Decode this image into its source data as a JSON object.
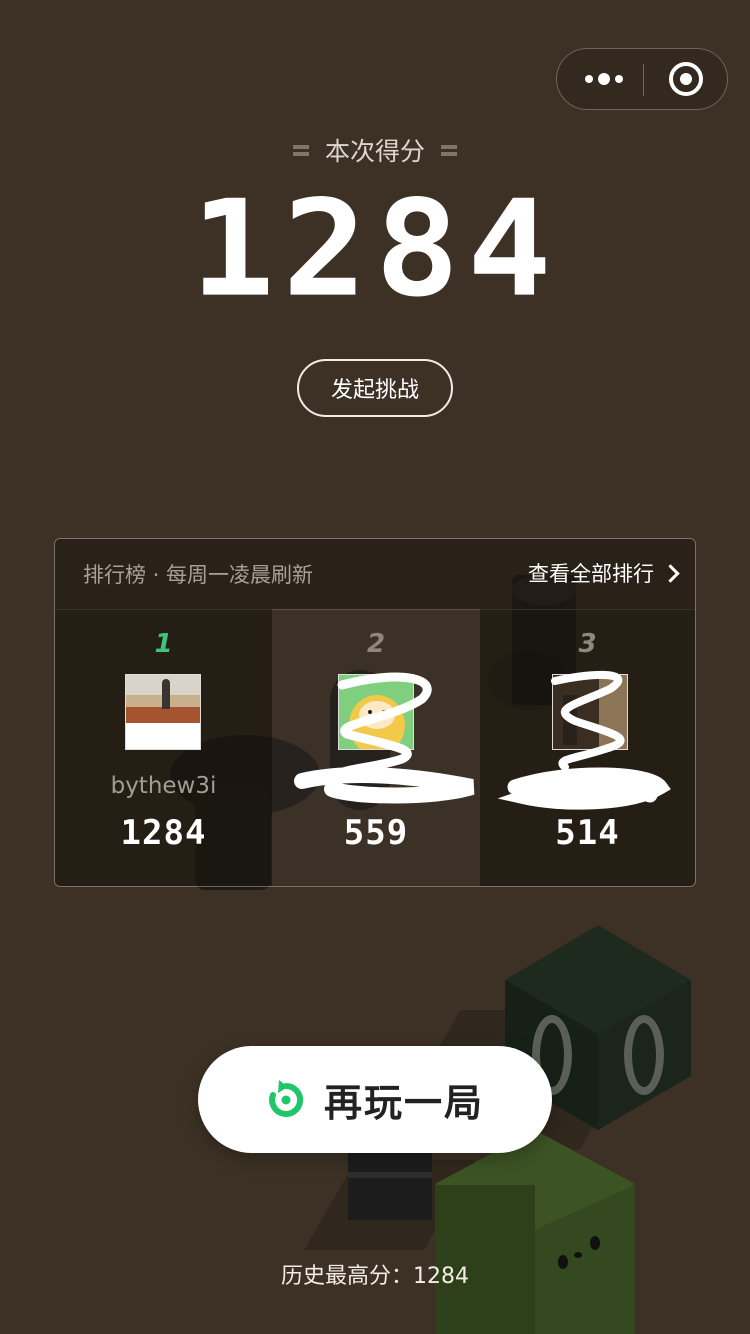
{
  "capsule": {
    "more_icon": "more-dots-icon",
    "close_icon": "target-circle-icon"
  },
  "score": {
    "caption": "本次得分",
    "value": "1284"
  },
  "challenge_button": "发起挑战",
  "leaderboard": {
    "title": "排行榜 · 每周一凌晨刷新",
    "view_all": "查看全部排行",
    "rank_color_first": "#3ec47a",
    "entries": [
      {
        "rank": "1",
        "name": "bythew3i",
        "score": "1284"
      },
      {
        "rank": "2",
        "name": "",
        "score": "559"
      },
      {
        "rank": "3",
        "name": "",
        "score": "514"
      }
    ]
  },
  "play_again": {
    "icon": "replay-icon",
    "label": "再玩一局",
    "icon_color": "#1fc66a"
  },
  "best_score": "历史最高分：1284"
}
